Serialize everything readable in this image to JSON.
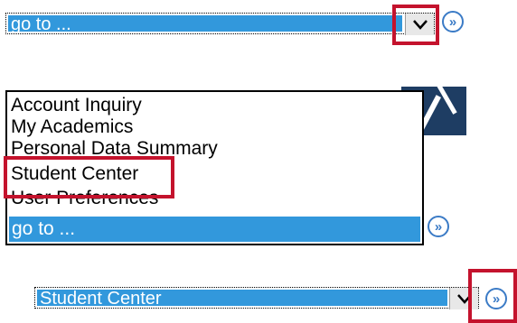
{
  "panel1": {
    "select_value": "go to ...",
    "arrow_glyph": "⌵",
    "go_glyph": "»"
  },
  "panel2": {
    "options": [
      "Account Inquiry",
      "My Academics",
      "Personal Data Summary",
      "Student Center",
      "User Preferences"
    ],
    "selected": "go to ...",
    "go_glyph": "»"
  },
  "panel3": {
    "select_value": "Student Center",
    "go_glyph": "»"
  },
  "colors": {
    "selection_blue": "#3298dc",
    "highlight_red": "#c4132d",
    "banner_navy": "#1e3d63",
    "go_button_blue": "#3b7bc6"
  },
  "icons": {
    "dropdown_arrow": "chevron-down-icon",
    "go_button": "double-chevron-right-icon"
  }
}
